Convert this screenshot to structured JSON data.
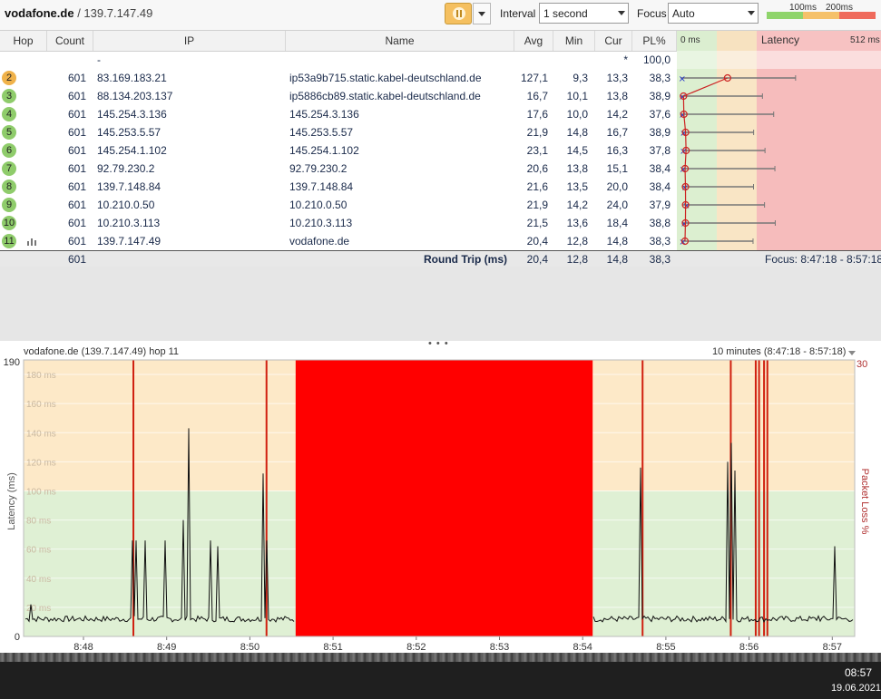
{
  "toolbar": {
    "host": "vodafone.de",
    "ip": "139.7.147.49",
    "interval_label": "Interval",
    "interval_value": "1 second",
    "focus_label": "Focus",
    "focus_value": "Auto",
    "legend_100": "100ms",
    "legend_200": "200ms",
    "legend_colors": [
      "#8fd46b",
      "#f5c16a",
      "#ef6a5c"
    ]
  },
  "table": {
    "headers": {
      "hop": "Hop",
      "count": "Count",
      "ip": "IP",
      "name": "Name",
      "avg": "Avg",
      "min": "Min",
      "cur": "Cur",
      "pl": "PL%",
      "latency": "Latency",
      "lat_min": "0 ms",
      "lat_max": "512 ms"
    },
    "first_row": {
      "ip": "-",
      "cur": "*",
      "pl": "100,0"
    },
    "rows": [
      {
        "hop": "2",
        "count": "601",
        "ip": "83.169.183.21",
        "name": "ip53a9b715.static.kabel-deutschland.de",
        "avg": "127,1",
        "min": "9,3",
        "cur": "13,3",
        "pl": "38,3",
        "status": "orange"
      },
      {
        "hop": "3",
        "count": "601",
        "ip": "88.134.203.137",
        "name": "ip5886cb89.static.kabel-deutschland.de",
        "avg": "16,7",
        "min": "10,1",
        "cur": "13,8",
        "pl": "38,9",
        "status": "green"
      },
      {
        "hop": "4",
        "count": "601",
        "ip": "145.254.3.136",
        "name": "145.254.3.136",
        "avg": "17,6",
        "min": "10,0",
        "cur": "14,2",
        "pl": "37,6",
        "status": "green"
      },
      {
        "hop": "5",
        "count": "601",
        "ip": "145.253.5.57",
        "name": "145.253.5.57",
        "avg": "21,9",
        "min": "14,8",
        "cur": "16,7",
        "pl": "38,9",
        "status": "green"
      },
      {
        "hop": "6",
        "count": "601",
        "ip": "145.254.1.102",
        "name": "145.254.1.102",
        "avg": "23,1",
        "min": "14,5",
        "cur": "16,3",
        "pl": "37,8",
        "status": "green"
      },
      {
        "hop": "7",
        "count": "601",
        "ip": "92.79.230.2",
        "name": "92.79.230.2",
        "avg": "20,6",
        "min": "13,8",
        "cur": "15,1",
        "pl": "38,4",
        "status": "green"
      },
      {
        "hop": "8",
        "count": "601",
        "ip": "139.7.148.84",
        "name": "139.7.148.84",
        "avg": "21,6",
        "min": "13,5",
        "cur": "20,0",
        "pl": "38,4",
        "status": "green"
      },
      {
        "hop": "9",
        "count": "601",
        "ip": "10.210.0.50",
        "name": "10.210.0.50",
        "avg": "21,9",
        "min": "14,2",
        "cur": "24,0",
        "pl": "37,9",
        "status": "green"
      },
      {
        "hop": "10",
        "count": "601",
        "ip": "10.210.3.113",
        "name": "10.210.3.113",
        "avg": "21,5",
        "min": "13,6",
        "cur": "18,4",
        "pl": "38,8",
        "status": "green"
      },
      {
        "hop": "11",
        "count": "601",
        "ip": "139.7.147.49",
        "name": "vodafone.de",
        "avg": "20,4",
        "min": "12,8",
        "cur": "14,8",
        "pl": "38,3",
        "status": "green"
      }
    ],
    "summary": {
      "count": "601",
      "label": "Round Trip (ms)",
      "avg": "20,4",
      "min": "12,8",
      "cur": "14,8",
      "pl": "38,3",
      "focus": "Focus: 8:47:18 - 8:57:18"
    }
  },
  "graph": {
    "title": "vodafone.de (139.7.147.49) hop 11",
    "range": "10 minutes (8:47:18 - 8:57:18)",
    "y_left_max": "190",
    "y_left_min": "0",
    "y_right_max": "30",
    "y_label": "Latency (ms)",
    "y_right_label": "Packet Loss %",
    "gridlines": [
      "180 ms",
      "160 ms",
      "140 ms",
      "120 ms",
      "100 ms",
      "80 ms",
      "60 ms",
      "40 ms",
      "20 ms"
    ],
    "x_ticks": [
      "8:48",
      "8:49",
      "8:50",
      "8:51",
      "8:52",
      "8:53",
      "8:54",
      "8:55",
      "8:56",
      "8:57"
    ]
  },
  "taskbar": {
    "time": "08:57",
    "date": "19.06.2021"
  }
}
